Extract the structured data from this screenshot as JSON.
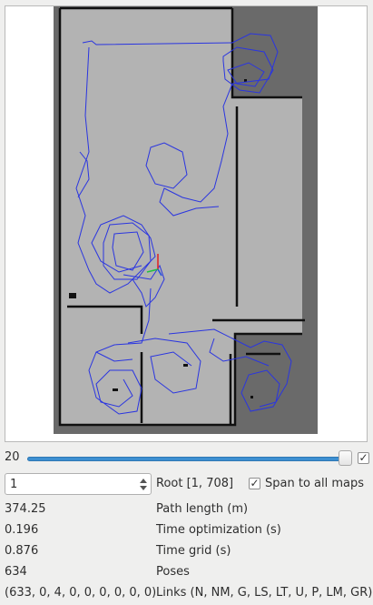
{
  "slider": {
    "value": "20",
    "check_mark": "✓"
  },
  "spin": {
    "value": "1"
  },
  "root_label": "Root [1, 708]",
  "span_checkbox": {
    "label": "Span to all maps",
    "check_mark": "✓"
  },
  "stats": [
    {
      "value": "374.25",
      "label": "Path length (m)"
    },
    {
      "value": "0.196",
      "label": "Time optimization (s)"
    },
    {
      "value": "0.876",
      "label": "Time grid (s)"
    },
    {
      "value": "634",
      "label": "Poses"
    },
    {
      "value": "(633, 0, 4, 0, 0, 0, 0, 0, 0)",
      "label": "Links (N, NM, G, LS, LT, U, P, LM, GR)"
    }
  ],
  "colors": {
    "trajectory": "#2a35e0",
    "free_space": "#b3b3b3",
    "unknown": "#6a6a6a",
    "wall": "#111111",
    "slider_accent": "#3d8fd1"
  }
}
